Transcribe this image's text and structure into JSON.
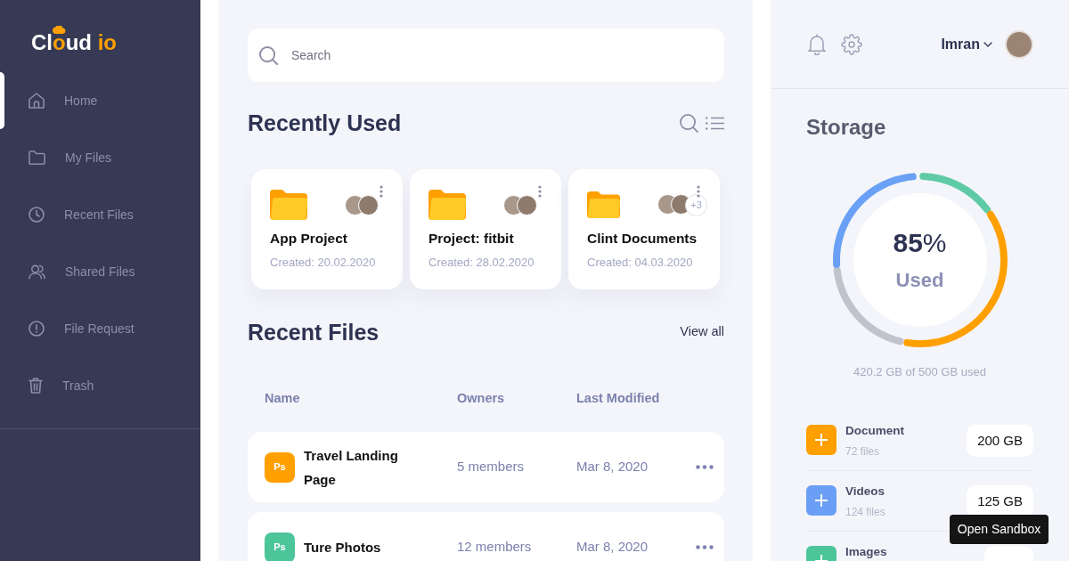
{
  "sidebar": {
    "logo": [
      {
        "text": "Cl",
        "accent": false
      },
      {
        "text": "o",
        "accent": true
      },
      {
        "text": "ud",
        "accent": false
      },
      {
        "text": " io",
        "accent": true
      }
    ],
    "items": [
      {
        "label": "Home",
        "selected": true
      },
      {
        "label": "My Files",
        "selected": false
      },
      {
        "label": "Recent Files",
        "selected": false
      },
      {
        "label": "Shared Files",
        "selected": false
      },
      {
        "label": "File Request",
        "selected": false
      },
      {
        "label": "Trash",
        "selected": false
      }
    ]
  },
  "search": {
    "placeholder": "Search"
  },
  "recently_used": {
    "title": "Recently Used",
    "cards": [
      {
        "name": "App Project",
        "created": "Created: 20.02.2020"
      },
      {
        "name": "Project: fitbit",
        "created": "Created: 28.02.2020"
      },
      {
        "name": "Clint Documents",
        "created": "Created: 04.03.2020",
        "more_members": "+3"
      }
    ]
  },
  "recent_files": {
    "title": "Recent Files",
    "view_all": "View all",
    "columns": [
      "Name",
      "Owners",
      "Last Modified"
    ],
    "rows": [
      {
        "badge": "Ps",
        "color": "#ffa000",
        "name": "Travel Landing Page",
        "owners": "5 members",
        "modified": "Mar 8, 2020"
      },
      {
        "badge": "Ps",
        "color": "#4cc59a",
        "name": "Ture Photos",
        "owners": "12 members",
        "modified": "Mar 8, 2020"
      }
    ]
  },
  "user": {
    "name": "Imran"
  },
  "storage": {
    "title": "Storage",
    "percent": "**85**%",
    "caption": "Used",
    "summary": "420.2 GB of 500 GB used",
    "categories": [
      {
        "name": "Document",
        "count": "72 files",
        "size": "200 GB",
        "color": "#ffa000"
      },
      {
        "name": "Videos",
        "count": "124 files",
        "size": "125 GB",
        "color": "#6b9ef5"
      },
      {
        "name": "Images",
        "color": "#4cc59a"
      }
    ]
  },
  "sandbox_button": {
    "label": "Open Sandbox"
  }
}
